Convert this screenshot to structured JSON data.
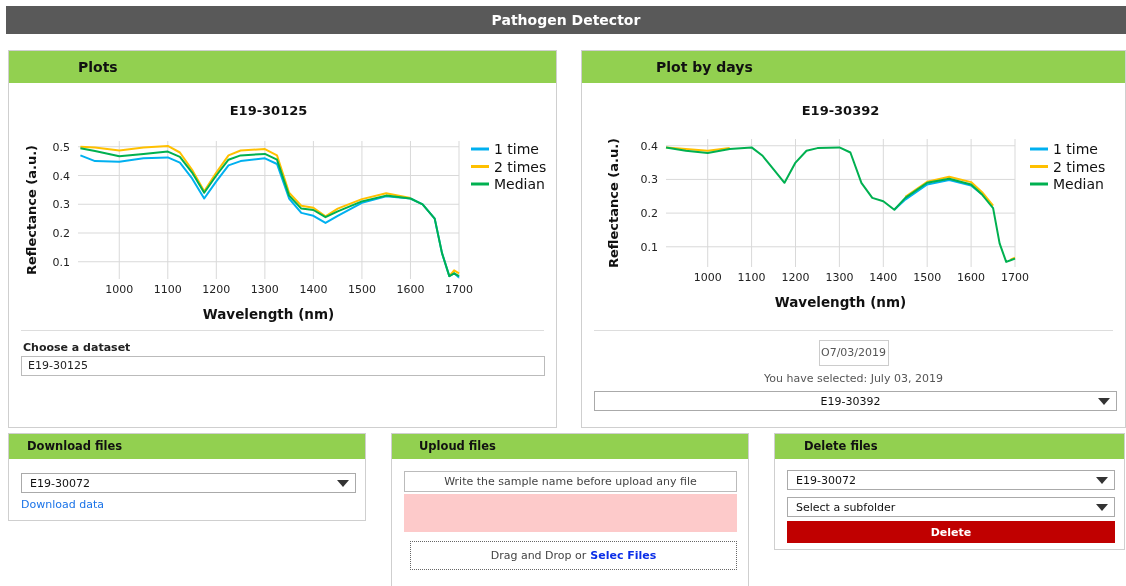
{
  "header": {
    "title": "Pathogen Detector"
  },
  "plots": {
    "title": "Plots",
    "chart_data": {
      "type": "line",
      "title": "E19-30125",
      "xlabel": "Wavelength (nm)",
      "ylabel": "Reflectance (a.u.)",
      "x": [
        920,
        950,
        1000,
        1050,
        1100,
        1125,
        1150,
        1175,
        1200,
        1225,
        1250,
        1300,
        1325,
        1350,
        1375,
        1400,
        1425,
        1450,
        1500,
        1550,
        1600,
        1625,
        1650,
        1665,
        1680,
        1690,
        1700
      ],
      "series": [
        {
          "name": "1 time",
          "color": "#00b0f0",
          "values": [
            0.47,
            0.45,
            0.448,
            0.46,
            0.463,
            0.445,
            0.39,
            0.32,
            0.38,
            0.435,
            0.45,
            0.46,
            0.44,
            0.32,
            0.27,
            0.26,
            0.235,
            0.26,
            0.305,
            0.328,
            0.32,
            0.3,
            0.25,
            0.13,
            0.05,
            0.06,
            0.045
          ]
        },
        {
          "name": "2 times",
          "color": "#ffc000",
          "values": [
            0.5,
            0.497,
            0.487,
            0.497,
            0.503,
            0.48,
            0.42,
            0.345,
            0.41,
            0.47,
            0.487,
            0.492,
            0.47,
            0.34,
            0.295,
            0.288,
            0.258,
            0.285,
            0.318,
            0.338,
            0.322,
            null,
            null,
            null,
            0.05,
            0.07,
            0.06
          ]
        },
        {
          "name": "Median",
          "color": "#00b050",
          "values": [
            0.495,
            0.485,
            0.467,
            0.475,
            0.483,
            0.465,
            0.41,
            0.34,
            0.4,
            0.455,
            0.47,
            0.475,
            0.455,
            0.33,
            0.285,
            0.28,
            0.255,
            0.275,
            0.31,
            0.33,
            0.32,
            0.3,
            0.25,
            0.13,
            0.05,
            0.06,
            0.05
          ]
        }
      ],
      "grid": true,
      "legend": true,
      "xlim": [
        915,
        1700
      ],
      "ylim": [
        0.04,
        0.52
      ],
      "xticks": [
        1000,
        1100,
        1200,
        1300,
        1400,
        1500,
        1600,
        1700
      ],
      "yticks": [
        0.1,
        0.2,
        0.3,
        0.4,
        0.5
      ]
    },
    "dataset_label": "Choose a dataset",
    "dataset_value": "E19-30125"
  },
  "plot_by_days": {
    "title": "Plot by days",
    "chart_data": {
      "type": "line",
      "title": "E19-30392",
      "xlabel": "Wavelength (nm)",
      "ylabel": "Reflectance (a.u.)",
      "x": [
        905,
        950,
        1000,
        1050,
        1100,
        1125,
        1150,
        1175,
        1200,
        1225,
        1250,
        1300,
        1325,
        1350,
        1375,
        1400,
        1425,
        1450,
        1500,
        1550,
        1600,
        1625,
        1650,
        1665,
        1680,
        1690,
        1700
      ],
      "series": [
        {
          "name": "1 time",
          "color": "#00b0f0",
          "values": [
            null,
            null,
            null,
            null,
            null,
            null,
            null,
            null,
            null,
            null,
            null,
            null,
            null,
            null,
            null,
            null,
            0.21,
            0.24,
            0.285,
            0.298,
            0.282,
            0.255,
            null,
            null,
            null,
            null,
            null
          ]
        },
        {
          "name": "2 times",
          "color": "#ffc000",
          "values": [
            0.395,
            0.39,
            0.385,
            0.393,
            null,
            null,
            null,
            null,
            null,
            null,
            null,
            null,
            null,
            null,
            null,
            null,
            null,
            0.248,
            0.293,
            0.308,
            0.292,
            0.262,
            0.222,
            null,
            null,
            0.062,
            0.068
          ]
        },
        {
          "name": "Median",
          "color": "#00b050",
          "values": [
            0.395,
            0.385,
            0.378,
            0.39,
            0.395,
            0.37,
            0.33,
            0.29,
            0.35,
            0.385,
            0.393,
            0.395,
            0.38,
            0.29,
            0.245,
            0.235,
            0.21,
            0.245,
            0.29,
            0.302,
            0.285,
            0.255,
            0.215,
            0.11,
            0.055,
            0.06,
            0.065
          ]
        }
      ],
      "grid": true,
      "legend": true,
      "xlim": [
        905,
        1700
      ],
      "ylim": [
        0.04,
        0.42
      ],
      "xticks": [
        1000,
        1100,
        1200,
        1300,
        1400,
        1500,
        1600,
        1700
      ],
      "yticks": [
        0.1,
        0.2,
        0.3,
        0.4
      ]
    },
    "date_value": "O7/03/2019",
    "selection_text": "You have selected: July 03, 2019",
    "sample_select": "E19-30392"
  },
  "download": {
    "title": "Download files",
    "sample_select": "E19-30072",
    "link": "Download data"
  },
  "upload": {
    "title": "Uploud files",
    "name_field": {
      "placeholder": "Write the sample name before upload any file"
    },
    "drop_text": "Drag and Drop or",
    "select_link": "Selec Files"
  },
  "delete": {
    "title": "Delete files",
    "sample_select": "E19-30072",
    "subfolder_select": "Select a subfolder",
    "button": "Delete"
  }
}
